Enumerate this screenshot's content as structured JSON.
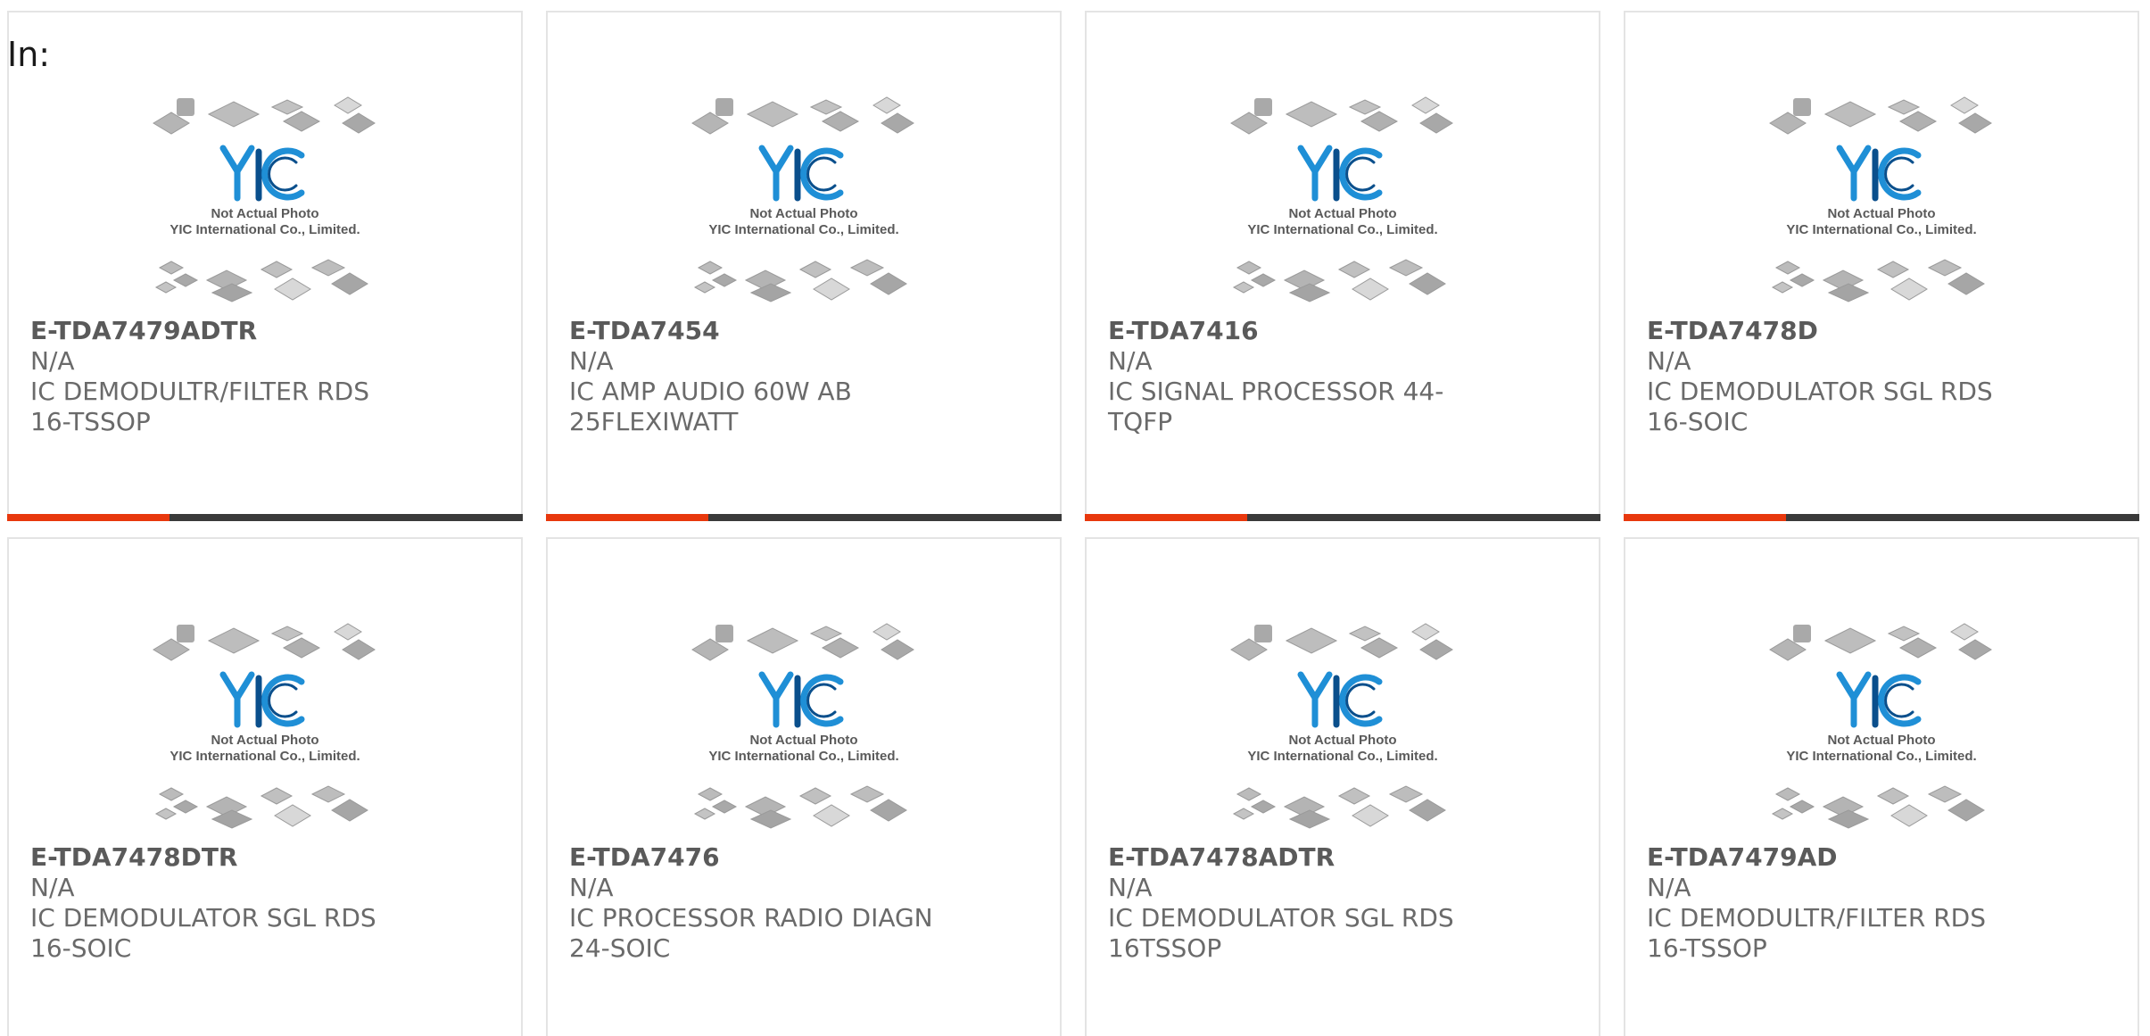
{
  "filter_label": "In:",
  "placeholder_image": {
    "caption_line1": "Not Actual Photo",
    "caption_line2": "YIC International Co., Limited."
  },
  "colors": {
    "accent": "#e8380d",
    "bar_dark": "#3a3a3a",
    "logo_blue": "#1f8fd6",
    "logo_dark_blue": "#0a4f8c",
    "card_border": "#e4e4e4"
  },
  "products": [
    {
      "part_number": "E-TDA7479ADTR",
      "manufacturer": "N/A",
      "description": "IC DEMODULTR/FILTER RDS 16-TSSOP"
    },
    {
      "part_number": "E-TDA7454",
      "manufacturer": "N/A",
      "description": "IC AMP AUDIO 60W AB 25FLEXIWATT"
    },
    {
      "part_number": "E-TDA7416",
      "manufacturer": "N/A",
      "description": "IC SIGNAL PROCESSOR 44-TQFP"
    },
    {
      "part_number": "E-TDA7478D",
      "manufacturer": "N/A",
      "description": "IC DEMODULATOR SGL RDS 16-SOIC"
    },
    {
      "part_number": "E-TDA7478DTR",
      "manufacturer": "N/A",
      "description": "IC DEMODULATOR SGL RDS 16-SOIC"
    },
    {
      "part_number": "E-TDA7476",
      "manufacturer": "N/A",
      "description": "IC PROCESSOR RADIO DIAGN 24-SOIC"
    },
    {
      "part_number": "E-TDA7478ADTR",
      "manufacturer": "N/A",
      "description": "IC DEMODULATOR SGL RDS 16TSSOP"
    },
    {
      "part_number": "E-TDA7479AD",
      "manufacturer": "N/A",
      "description": "IC DEMODULTR/FILTER RDS 16-TSSOP"
    }
  ]
}
